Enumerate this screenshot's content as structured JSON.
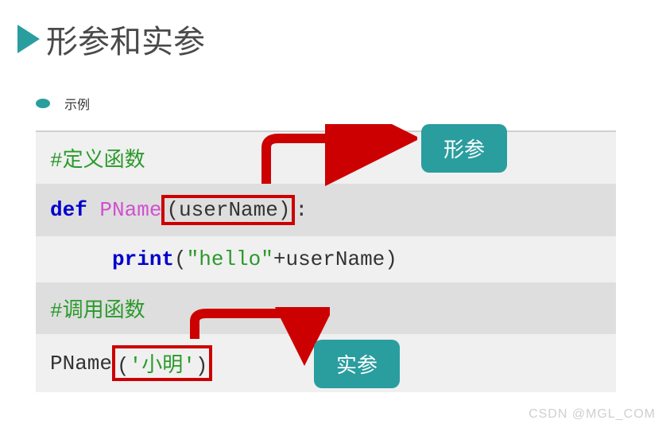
{
  "title": "形参和实参",
  "subtitle": "示例",
  "badges": {
    "formal": "形参",
    "actual": "实参"
  },
  "code": {
    "comment_define": "#定义函数",
    "def_kw": "def",
    "func_name": " PName",
    "param_open": "(",
    "param_name": "userName",
    "param_close": ")",
    "colon": ":",
    "indent": "     ",
    "print_kw": "print",
    "print_open": "(",
    "hello_str": "\"hello\"",
    "plus": "+",
    "print_param": "userName",
    "print_close": ")",
    "comment_call": "#调用函数",
    "call_name": "PName",
    "arg_open": "(",
    "arg_str": "'小明'",
    "arg_close": ")"
  },
  "watermark": "CSDN @MGL_COM"
}
